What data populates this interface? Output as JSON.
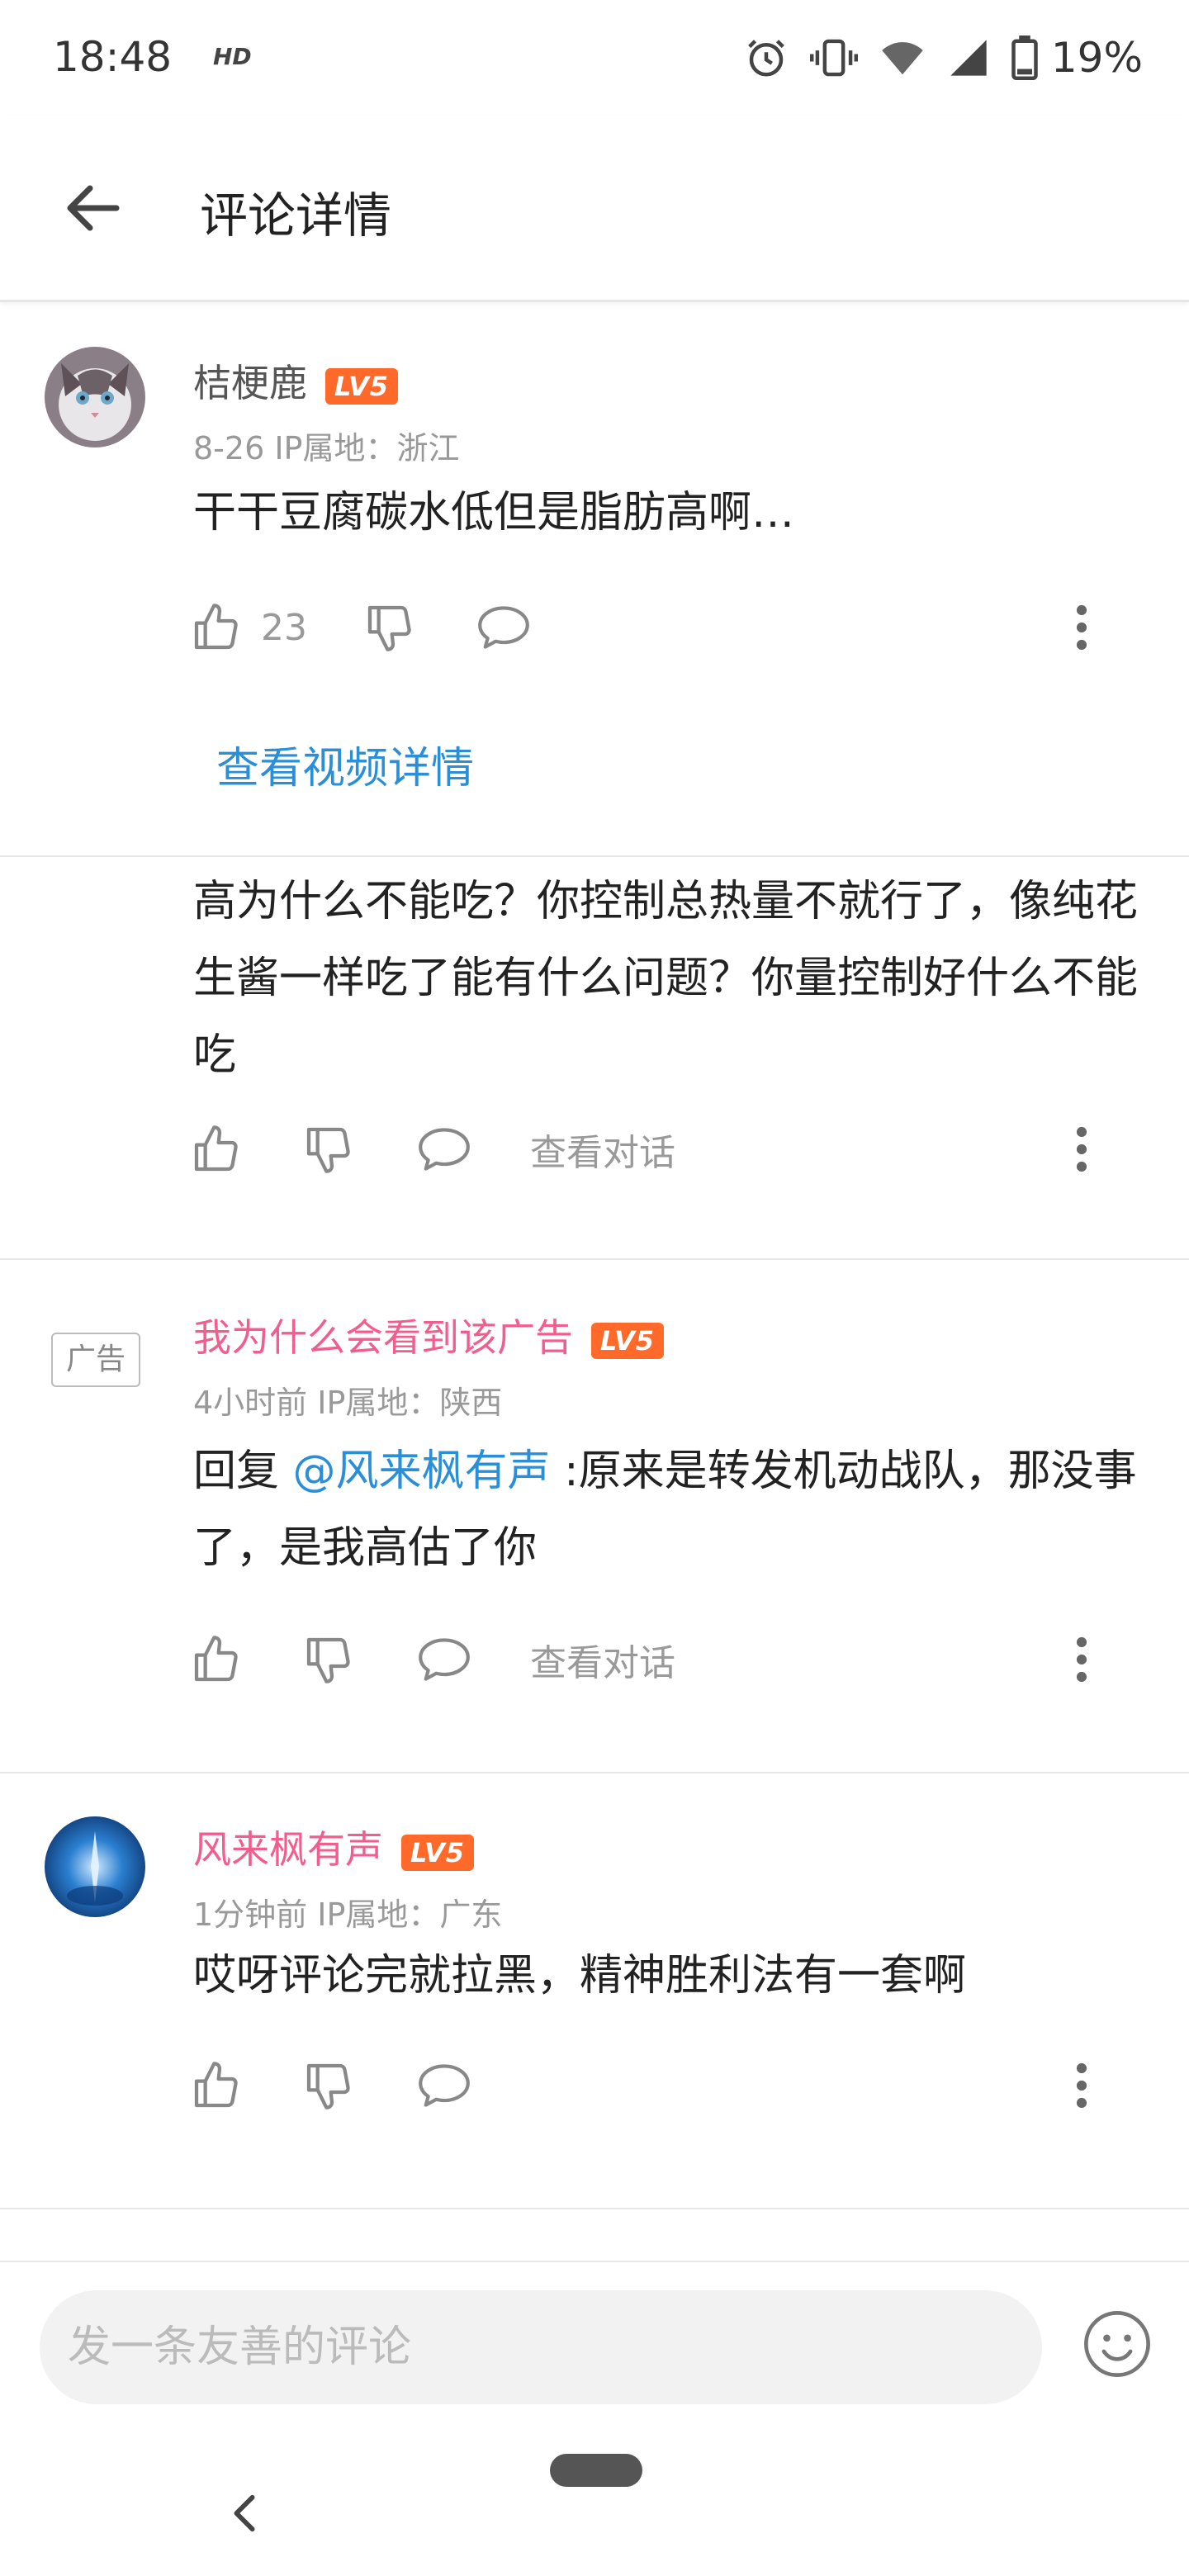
{
  "status_bar": {
    "time": "18:48",
    "hd": "HD",
    "battery": "19%",
    "icons": [
      "alarm-icon",
      "vibrate-icon",
      "wifi-icon",
      "signal-icon",
      "battery-icon"
    ]
  },
  "header": {
    "title": "评论详情",
    "back_icon": "arrow-left-icon"
  },
  "root_comment": {
    "username": "桔梗鹿",
    "level": "LV5",
    "meta": "8-26  IP属地：浙江",
    "content": "干干豆腐碳水低但是脂肪高啊…",
    "like_count": "23",
    "view_video_link": "查看视频详情"
  },
  "reply_partial": {
    "content": "高为什么不能吃？你控制总热量不就行了，像纯花生酱一样吃了能有什么问题？你量控制好什么不能吃",
    "view_dialog": "查看对话"
  },
  "ad_reply": {
    "ad_tag": "广告",
    "username": "我为什么会看到该广告",
    "level": "LV5",
    "meta": "4小时前  IP属地：陕西",
    "reply_prefix": "回复 ",
    "mention": "@风来枫有声",
    "content_rest": " :原来是转发机动战队，那没事了，是我高估了你",
    "view_dialog": "查看对话"
  },
  "last_reply": {
    "username": "风来枫有声",
    "level": "LV5",
    "meta": "1分钟前  IP属地：广东",
    "content": "哎呀评论完就拉黑，精神胜利法有一套啊"
  },
  "bottom": {
    "input_placeholder": "发一条友善的评论",
    "emoji_icon": "smiley-icon"
  },
  "colors": {
    "accent_pink": "#f25d8e",
    "link_blue": "#2b8fd8",
    "level_orange": "#ff6a2a"
  }
}
